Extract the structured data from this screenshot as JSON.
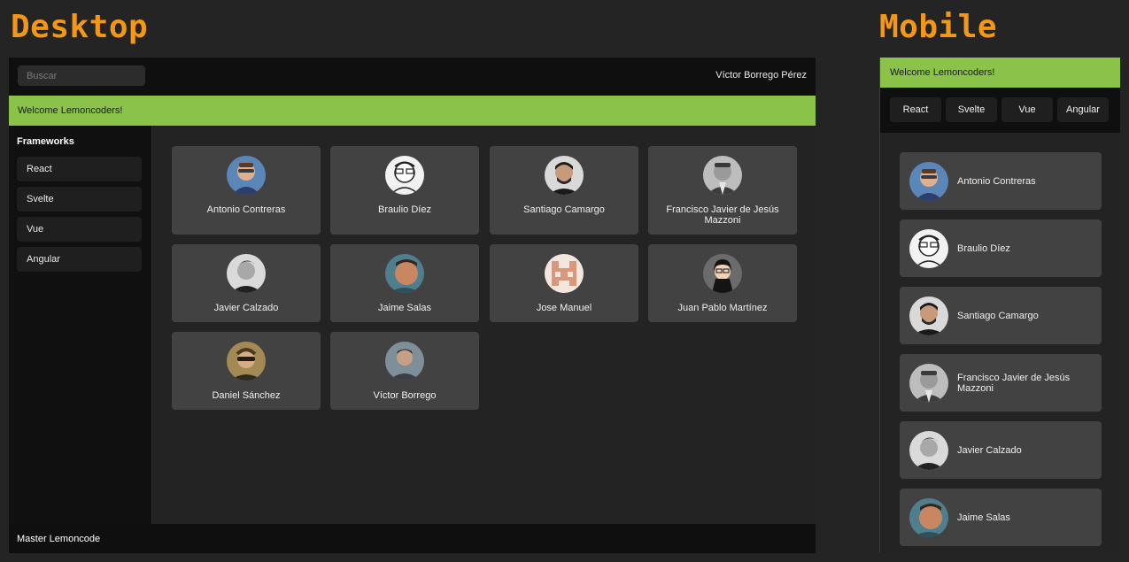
{
  "headings": {
    "desktop": "Desktop",
    "mobile": "Mobile"
  },
  "desktop": {
    "search": {
      "placeholder": "Buscar",
      "value": ""
    },
    "user_name": "Víctor Borrego Pérez",
    "welcome": "Welcome Lemoncoders!",
    "sidebar": {
      "title": "Frameworks",
      "items": [
        {
          "label": "React"
        },
        {
          "label": "Svelte"
        },
        {
          "label": "Vue"
        },
        {
          "label": "Angular"
        }
      ]
    },
    "members": [
      {
        "name": "Antonio Contreras",
        "avatar": "avatar-antonio-icon"
      },
      {
        "name": "Braulio Díez",
        "avatar": "avatar-braulio-icon"
      },
      {
        "name": "Santiago Camargo",
        "avatar": "avatar-santiago-icon"
      },
      {
        "name": "Francisco Javier de Jesús Mazzoni",
        "avatar": "avatar-francisco-icon"
      },
      {
        "name": "Javier Calzado",
        "avatar": "avatar-javier-icon"
      },
      {
        "name": "Jaime Salas",
        "avatar": "avatar-jaime-icon"
      },
      {
        "name": "Jose Manuel",
        "avatar": "avatar-jose-icon"
      },
      {
        "name": "Juan Pablo Martínez",
        "avatar": "avatar-juanpablo-icon"
      },
      {
        "name": "Daniel Sánchez",
        "avatar": "avatar-daniel-icon"
      },
      {
        "name": "Víctor Borrego",
        "avatar": "avatar-victor-icon"
      }
    ],
    "footer": "Master Lemoncode"
  },
  "mobile": {
    "welcome": "Welcome Lemoncoders!",
    "nav": [
      {
        "label": "React"
      },
      {
        "label": "Svelte"
      },
      {
        "label": "Vue"
      },
      {
        "label": "Angular"
      }
    ],
    "members": [
      {
        "name": "Antonio Contreras"
      },
      {
        "name": "Braulio Díez"
      },
      {
        "name": "Santiago Camargo"
      },
      {
        "name": "Francisco Javier de Jesús Mazzoni"
      },
      {
        "name": "Javier Calzado"
      },
      {
        "name": "Jaime Salas"
      }
    ]
  },
  "colors": {
    "accent_heading": "#f29718",
    "welcome_bar": "#8bc34a",
    "card": "#424242",
    "bar_dark": "#0f0f0f",
    "background": "#242424"
  }
}
